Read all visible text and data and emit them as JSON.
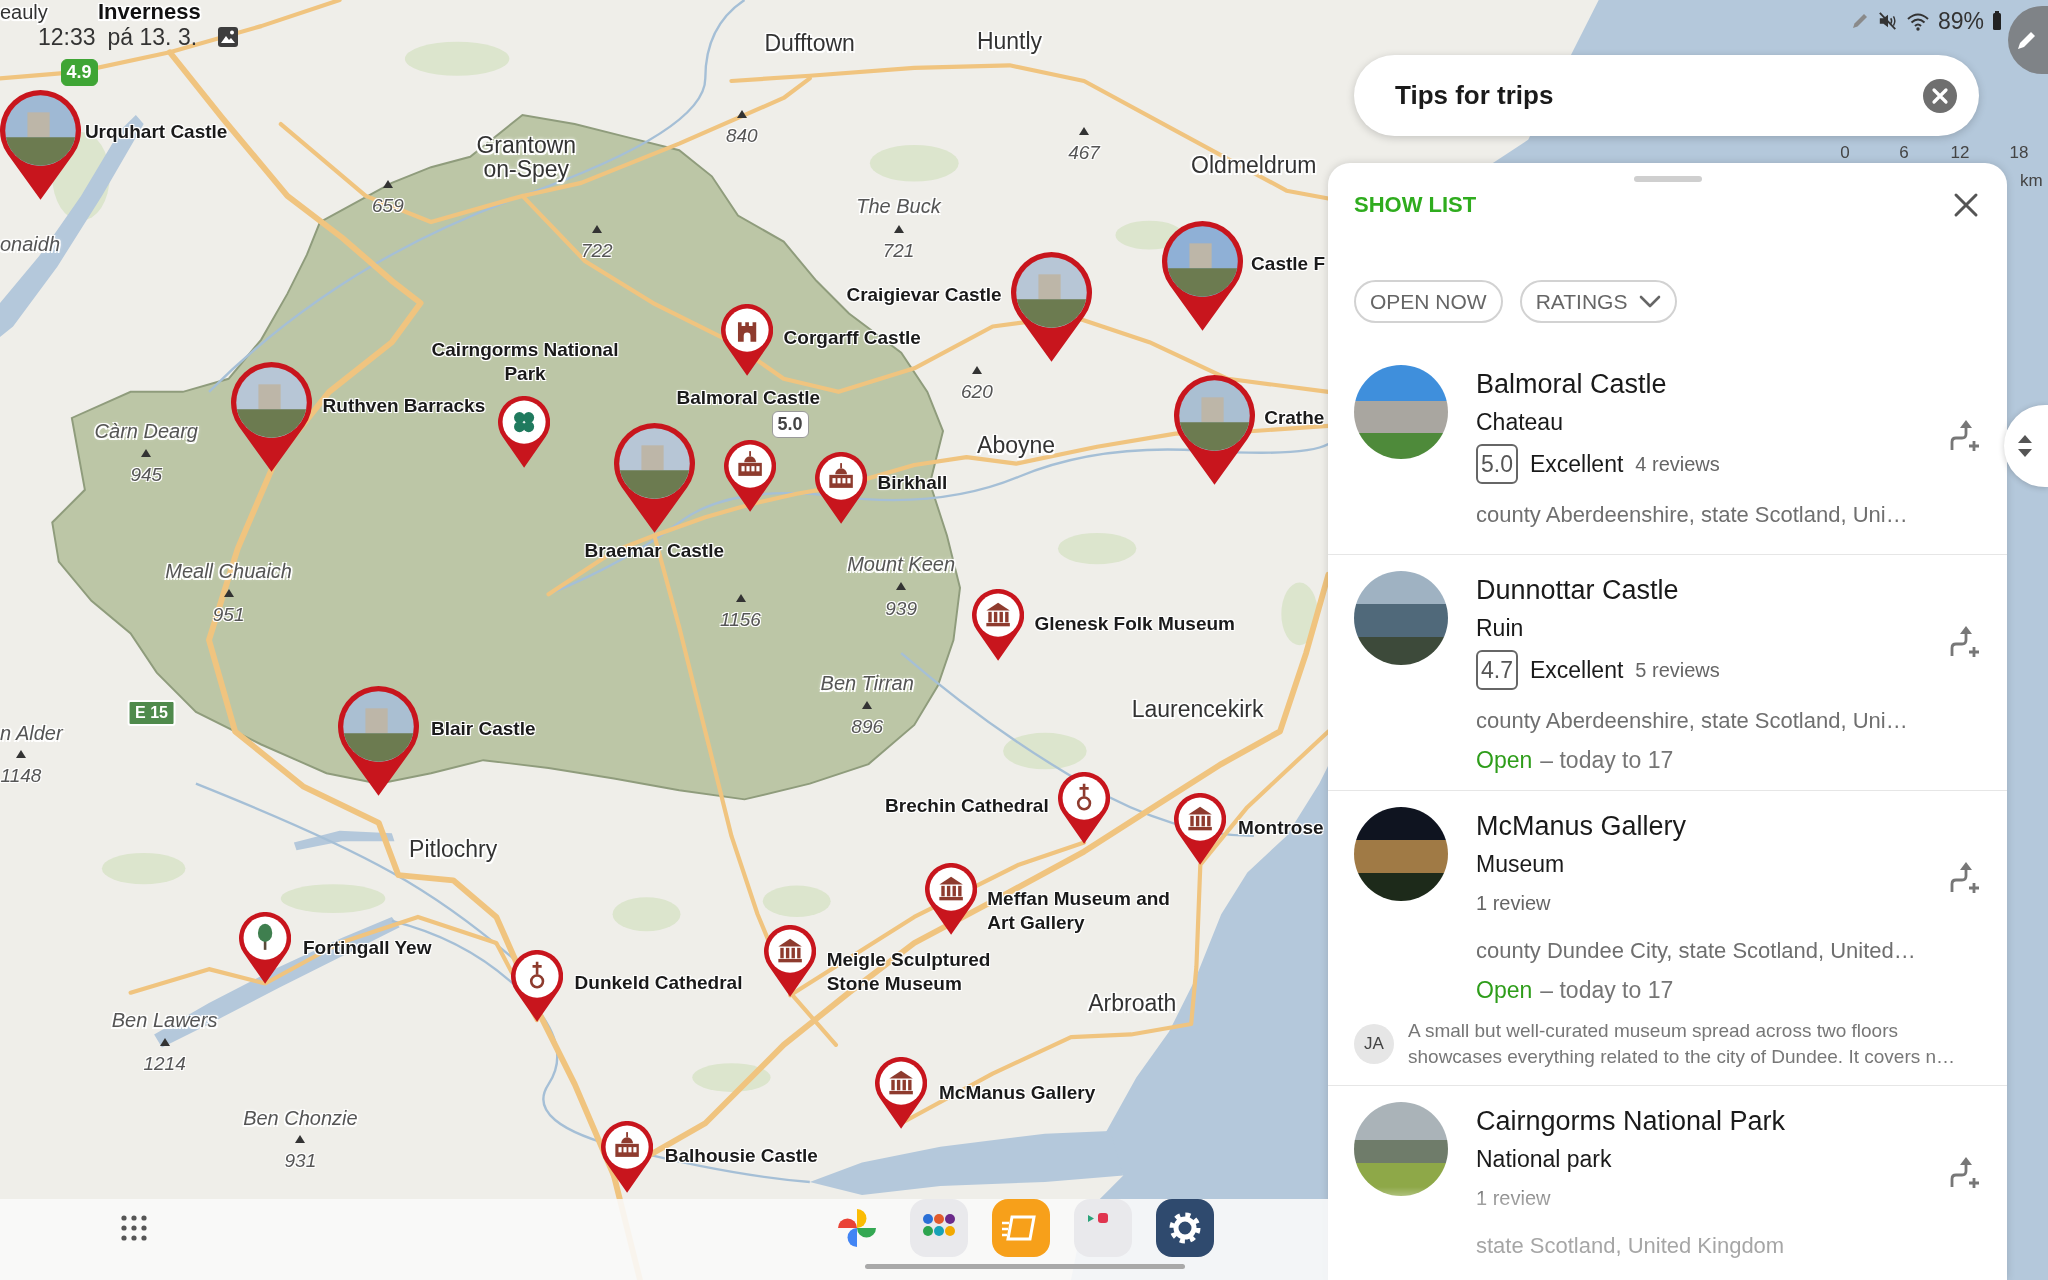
{
  "status_bar": {
    "time": "12:33",
    "date": "pá 13. 3.",
    "battery": "89%"
  },
  "map": {
    "towns": [
      {
        "name": "eauly",
        "kind": "town"
      },
      {
        "name": "Inverness",
        "kind": "city"
      },
      {
        "name": "Dufftown",
        "kind": "town"
      },
      {
        "name": "Huntly",
        "kind": "town"
      },
      {
        "name": "Grantown on-Spey",
        "kind": "town"
      },
      {
        "name": "Oldmeldrum",
        "kind": "town"
      },
      {
        "name": "Aboyne",
        "kind": "town"
      },
      {
        "name": "Laurencekirk",
        "kind": "town"
      },
      {
        "name": "Pitlochry",
        "kind": "town"
      },
      {
        "name": "Arbroath",
        "kind": "town"
      }
    ],
    "peaks": [
      {
        "elevation": "840"
      },
      {
        "elevation": "467"
      },
      {
        "elevation": "659"
      },
      {
        "name": "onaidh"
      },
      {
        "elevation": "722"
      },
      {
        "name": "The Buck",
        "elevation": "721"
      },
      {
        "elevation": "620"
      },
      {
        "name": "Càrn Dearg",
        "elevation": "945"
      },
      {
        "name": "Meall Chuaich",
        "elevation": "951"
      },
      {
        "elevation": "1156"
      },
      {
        "name": "Mount Keen",
        "elevation": "939"
      },
      {
        "name": "n Alder",
        "elevation": "1148"
      },
      {
        "name": "Ben Tirran",
        "elevation": "896"
      },
      {
        "name": "Ben Lawers",
        "elevation": "1214"
      },
      {
        "name": "Ben Chonzie",
        "elevation": "931"
      }
    ],
    "road_signs": [
      "E 15"
    ],
    "places": [
      {
        "name": "Urquhart Castle",
        "kind": "photo",
        "rating": "4.9",
        "rating_highlighted": true
      },
      {
        "name": "Craigievar Castle",
        "kind": "photo"
      },
      {
        "name": "Castle F",
        "kind": "photo"
      },
      {
        "name": "Corgarff Castle",
        "kind": "castle"
      },
      {
        "name": "Cairngorms National Park",
        "kind": "park"
      },
      {
        "name": "Ruthven Barracks",
        "kind": "photo"
      },
      {
        "name": "Balmoral Castle",
        "kind": "palace",
        "rating": "5.0",
        "rating_highlighted": false
      },
      {
        "name": "Crathe",
        "kind": "photo"
      },
      {
        "name": "Birkhall",
        "kind": "palace"
      },
      {
        "name": "Braemar Castle",
        "kind": "photo"
      },
      {
        "name": "Glenesk Folk Museum",
        "kind": "museum"
      },
      {
        "name": "Blair Castle",
        "kind": "photo"
      },
      {
        "name": "Brechin Cathedral",
        "kind": "church"
      },
      {
        "name": "Montrose",
        "kind": "museum"
      },
      {
        "name": "Meffan Museum and Art Gallery",
        "kind": "museum"
      },
      {
        "name": "Fortingall Yew",
        "kind": "tree"
      },
      {
        "name": "Dunkeld Cathedral",
        "kind": "church"
      },
      {
        "name": "Meigle Sculptured Stone Museum",
        "kind": "museum"
      },
      {
        "name": "McManus Gallery",
        "kind": "museum"
      },
      {
        "name": "Balhousie Castle",
        "kind": "palace"
      }
    ],
    "scale": {
      "ticks": [
        "0",
        "6",
        "12",
        "18"
      ],
      "unit": "km"
    }
  },
  "search": {
    "value": "Tips for trips"
  },
  "panel": {
    "action": "SHOW LIST",
    "filters": [
      {
        "label": "OPEN NOW",
        "kind": "toggle",
        "selected": false
      },
      {
        "label": "RATINGS",
        "kind": "dropdown",
        "selected": false
      }
    ],
    "results": [
      {
        "name": "Balmoral Castle",
        "type": "Chateau",
        "rating": "5.0",
        "verdict": "Excellent",
        "reviews": "4 reviews",
        "address": "county Aberdeenshire, state Scotland, Uni…"
      },
      {
        "name": "Dunnottar Castle",
        "type": "Ruin",
        "rating": "4.7",
        "verdict": "Excellent",
        "reviews": "5 reviews",
        "address": "county Aberdeenshire, state Scotland, Uni…",
        "open": {
          "status": "Open",
          "hours": "– today to 17",
          "is_open": true
        }
      },
      {
        "name": "McManus Gallery",
        "type": "Museum",
        "reviews": "1 review",
        "address": "county Dundee City, state Scotland, United…",
        "open": {
          "status": "Open",
          "hours": "– today to 17",
          "is_open": true
        },
        "review": {
          "author": "JA",
          "text": "A small but well-curated museum spread across two floors showcases everything related to the city of Dundee. It covers n…"
        }
      },
      {
        "name": "Cairngorms National Park",
        "type": "National park",
        "reviews": "1 review",
        "address": "state Scotland, United Kingdom"
      }
    ]
  }
}
